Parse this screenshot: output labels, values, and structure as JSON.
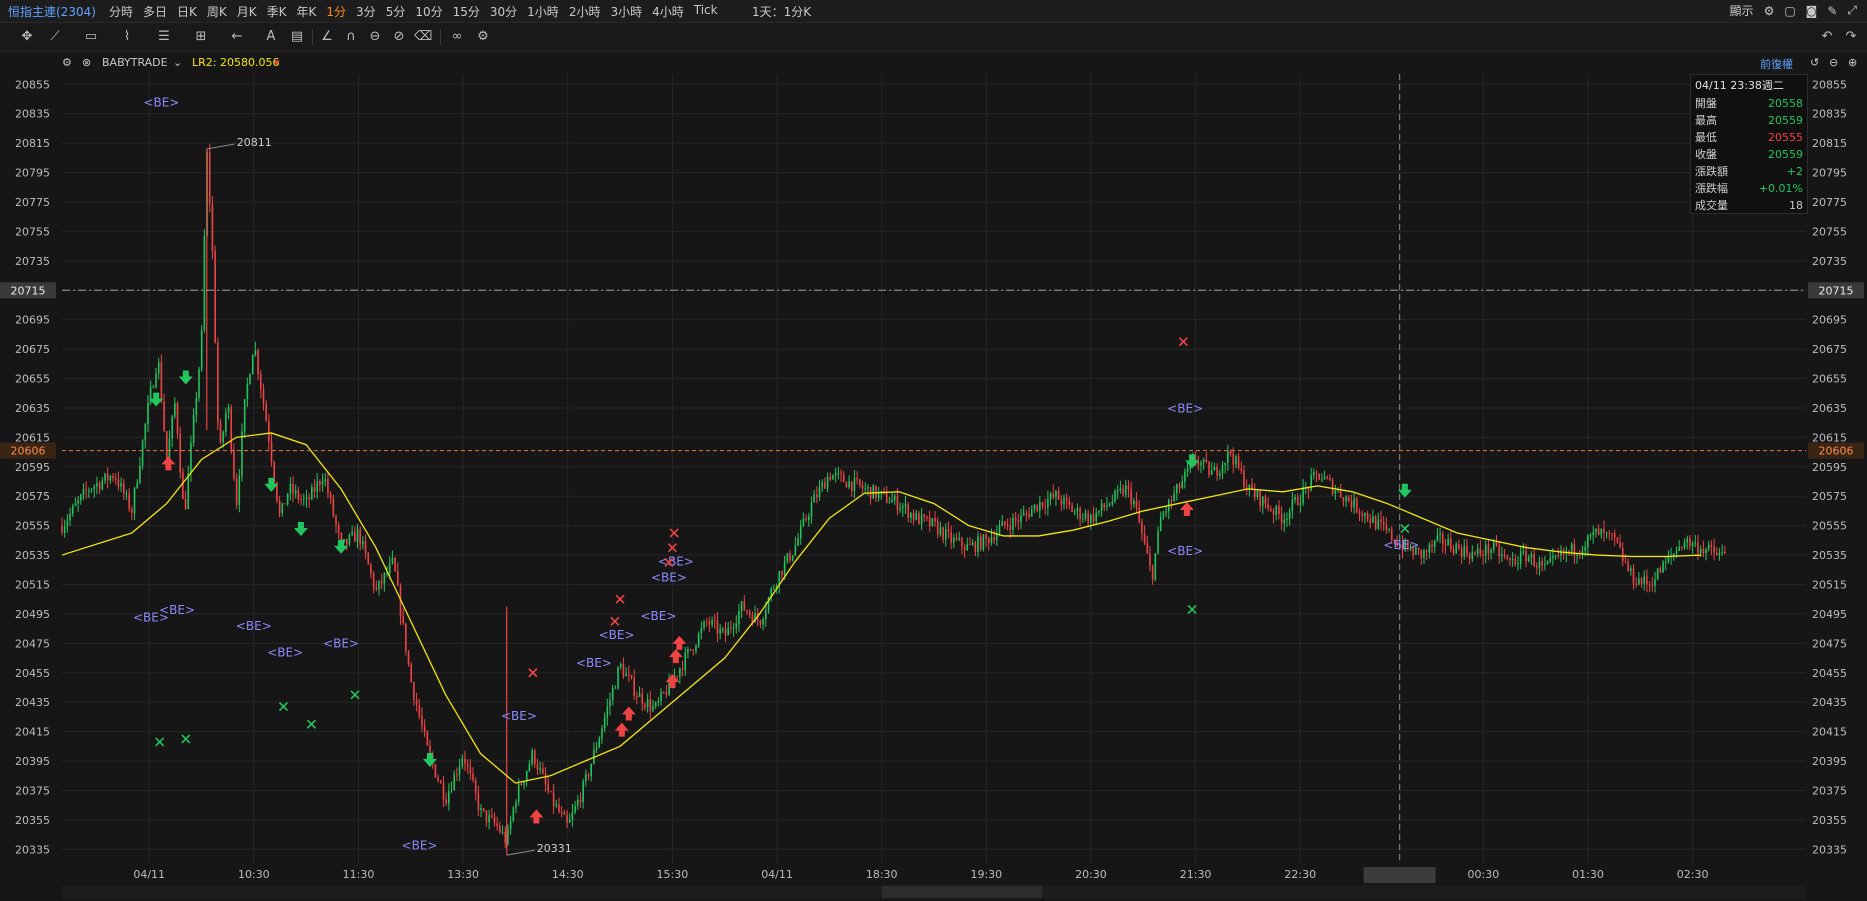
{
  "header": {
    "title": "恒指主連(2304)",
    "periods": [
      {
        "label": "分時"
      },
      {
        "label": "多日"
      },
      {
        "label": "日K"
      },
      {
        "label": "周K"
      },
      {
        "label": "月K"
      },
      {
        "label": "季K"
      },
      {
        "label": "年K"
      },
      {
        "label": "1分",
        "active": true
      },
      {
        "label": "3分"
      },
      {
        "label": "5分"
      },
      {
        "label": "10分"
      },
      {
        "label": "15分"
      },
      {
        "label": "30分"
      },
      {
        "label": "1小時"
      },
      {
        "label": "2小時"
      },
      {
        "label": "3小時"
      },
      {
        "label": "4小時"
      },
      {
        "label": "Tick"
      }
    ],
    "range_select": "1天：1分K",
    "display_label": "顯示",
    "restore_label": "前復權"
  },
  "indicator": {
    "name": "BABYTRADE",
    "lr2_label": "LR2:",
    "lr2_value": "20580.056"
  },
  "infobox": {
    "date": "04/11 23:38週二",
    "rows": [
      {
        "label": "開盤",
        "value": "20558",
        "color": "#22c55e"
      },
      {
        "label": "最高",
        "value": "20559",
        "color": "#22c55e"
      },
      {
        "label": "最低",
        "value": "20555",
        "color": "#ef4444"
      },
      {
        "label": "收盤",
        "value": "20559",
        "color": "#22c55e"
      },
      {
        "label": "漲跌額",
        "value": "+2",
        "color": "#22c55e"
      },
      {
        "label": "漲跌幅",
        "value": "+0.01%",
        "color": "#22c55e"
      },
      {
        "label": "成交量",
        "value": "18",
        "color": "#c8c8c8"
      }
    ]
  },
  "chart_data": {
    "type": "candlestick",
    "y_ticks": [
      20855,
      20835,
      20815,
      20795,
      20775,
      20755,
      20735,
      20715,
      20695,
      20675,
      20655,
      20635,
      20615,
      20595,
      20575,
      20555,
      20535,
      20515,
      20495,
      20475,
      20455,
      20435,
      20415,
      20395,
      20375,
      20355,
      20335
    ],
    "ylim": [
      20325,
      20862
    ],
    "x_ticks": [
      {
        "label": "04/11",
        "t": 0.05
      },
      {
        "label": "10:30",
        "t": 0.11
      },
      {
        "label": "11:30",
        "t": 0.17
      },
      {
        "label": "13:30",
        "t": 0.23
      },
      {
        "label": "14:30",
        "t": 0.29
      },
      {
        "label": "15:30",
        "t": 0.35
      },
      {
        "label": "04/11",
        "t": 0.41
      },
      {
        "label": "18:30",
        "t": 0.47
      },
      {
        "label": "19:30",
        "t": 0.53
      },
      {
        "label": "20:30",
        "t": 0.59
      },
      {
        "label": "21:30",
        "t": 0.65
      },
      {
        "label": "22:30",
        "t": 0.71
      },
      {
        "label": "04/11 23:38",
        "t": 0.767
      },
      {
        "label": "00:30",
        "t": 0.815
      },
      {
        "label": "01:30",
        "t": 0.875
      },
      {
        "label": "02:30",
        "t": 0.935
      }
    ],
    "price_path": [
      [
        0,
        20555
      ],
      [
        0.015,
        20580
      ],
      [
        0.03,
        20590
      ],
      [
        0.04,
        20565
      ],
      [
        0.05,
        20640
      ],
      [
        0.055,
        20670
      ],
      [
        0.06,
        20600
      ],
      [
        0.065,
        20640
      ],
      [
        0.07,
        20560
      ],
      [
        0.075,
        20620
      ],
      [
        0.08,
        20680
      ],
      [
        0.083,
        20810
      ],
      [
        0.086,
        20750
      ],
      [
        0.09,
        20600
      ],
      [
        0.095,
        20640
      ],
      [
        0.1,
        20570
      ],
      [
        0.105,
        20640
      ],
      [
        0.11,
        20680
      ],
      [
        0.118,
        20620
      ],
      [
        0.125,
        20560
      ],
      [
        0.13,
        20580
      ],
      [
        0.14,
        20570
      ],
      [
        0.15,
        20590
      ],
      [
        0.16,
        20540
      ],
      [
        0.17,
        20550
      ],
      [
        0.18,
        20510
      ],
      [
        0.19,
        20530
      ],
      [
        0.2,
        20450
      ],
      [
        0.21,
        20400
      ],
      [
        0.22,
        20370
      ],
      [
        0.23,
        20400
      ],
      [
        0.24,
        20360
      ],
      [
        0.25,
        20350
      ],
      [
        0.255,
        20340
      ],
      [
        0.26,
        20370
      ],
      [
        0.27,
        20400
      ],
      [
        0.28,
        20370
      ],
      [
        0.29,
        20350
      ],
      [
        0.3,
        20380
      ],
      [
        0.31,
        20420
      ],
      [
        0.32,
        20460
      ],
      [
        0.33,
        20440
      ],
      [
        0.34,
        20430
      ],
      [
        0.35,
        20450
      ],
      [
        0.36,
        20470
      ],
      [
        0.37,
        20490
      ],
      [
        0.38,
        20480
      ],
      [
        0.39,
        20500
      ],
      [
        0.4,
        20490
      ],
      [
        0.41,
        20520
      ],
      [
        0.42,
        20540
      ],
      [
        0.43,
        20570
      ],
      [
        0.44,
        20590
      ],
      [
        0.45,
        20585
      ],
      [
        0.46,
        20580
      ],
      [
        0.47,
        20575
      ],
      [
        0.48,
        20570
      ],
      [
        0.49,
        20560
      ],
      [
        0.5,
        20555
      ],
      [
        0.51,
        20545
      ],
      [
        0.52,
        20540
      ],
      [
        0.53,
        20545
      ],
      [
        0.54,
        20555
      ],
      [
        0.55,
        20560
      ],
      [
        0.56,
        20570
      ],
      [
        0.57,
        20575
      ],
      [
        0.58,
        20565
      ],
      [
        0.59,
        20560
      ],
      [
        0.6,
        20570
      ],
      [
        0.61,
        20580
      ],
      [
        0.615,
        20570
      ],
      [
        0.62,
        20545
      ],
      [
        0.625,
        20520
      ],
      [
        0.63,
        20560
      ],
      [
        0.64,
        20580
      ],
      [
        0.65,
        20600
      ],
      [
        0.66,
        20590
      ],
      [
        0.67,
        20605
      ],
      [
        0.68,
        20580
      ],
      [
        0.69,
        20570
      ],
      [
        0.7,
        20560
      ],
      [
        0.71,
        20575
      ],
      [
        0.72,
        20590
      ],
      [
        0.73,
        20580
      ],
      [
        0.74,
        20570
      ],
      [
        0.75,
        20560
      ],
      [
        0.76,
        20550
      ],
      [
        0.77,
        20540
      ],
      [
        0.78,
        20535
      ],
      [
        0.79,
        20545
      ],
      [
        0.8,
        20540
      ],
      [
        0.81,
        20535
      ],
      [
        0.82,
        20540
      ],
      [
        0.83,
        20530
      ],
      [
        0.84,
        20535
      ],
      [
        0.85,
        20525
      ],
      [
        0.86,
        20535
      ],
      [
        0.87,
        20540
      ],
      [
        0.88,
        20550
      ],
      [
        0.89,
        20545
      ],
      [
        0.9,
        20520
      ],
      [
        0.91,
        20515
      ],
      [
        0.92,
        20530
      ],
      [
        0.93,
        20545
      ],
      [
        0.94,
        20540
      ],
      [
        0.95,
        20535
      ]
    ],
    "lr2_line": [
      [
        0,
        20535
      ],
      [
        0.04,
        20550
      ],
      [
        0.06,
        20570
      ],
      [
        0.08,
        20600
      ],
      [
        0.1,
        20615
      ],
      [
        0.12,
        20618
      ],
      [
        0.14,
        20610
      ],
      [
        0.16,
        20580
      ],
      [
        0.18,
        20540
      ],
      [
        0.2,
        20490
      ],
      [
        0.22,
        20440
      ],
      [
        0.24,
        20400
      ],
      [
        0.26,
        20380
      ],
      [
        0.28,
        20385
      ],
      [
        0.3,
        20395
      ],
      [
        0.32,
        20405
      ],
      [
        0.34,
        20425
      ],
      [
        0.36,
        20445
      ],
      [
        0.38,
        20465
      ],
      [
        0.4,
        20495
      ],
      [
        0.42,
        20530
      ],
      [
        0.44,
        20560
      ],
      [
        0.46,
        20577
      ],
      [
        0.48,
        20578
      ],
      [
        0.5,
        20570
      ],
      [
        0.52,
        20555
      ],
      [
        0.54,
        20548
      ],
      [
        0.56,
        20548
      ],
      [
        0.58,
        20552
      ],
      [
        0.6,
        20558
      ],
      [
        0.62,
        20565
      ],
      [
        0.64,
        20570
      ],
      [
        0.66,
        20575
      ],
      [
        0.68,
        20580
      ],
      [
        0.7,
        20578
      ],
      [
        0.72,
        20582
      ],
      [
        0.74,
        20578
      ],
      [
        0.76,
        20570
      ],
      [
        0.78,
        20560
      ],
      [
        0.8,
        20550
      ],
      [
        0.82,
        20545
      ],
      [
        0.84,
        20540
      ],
      [
        0.86,
        20537
      ],
      [
        0.88,
        20535
      ],
      [
        0.9,
        20534
      ],
      [
        0.92,
        20534
      ],
      [
        0.94,
        20535
      ]
    ],
    "h_lines": [
      {
        "value": 20715,
        "label": "20715",
        "color": "#9a9a9a",
        "style": "dashdot"
      },
      {
        "value": 20606,
        "label": "20606",
        "color": "#e07b39",
        "style": "dashed"
      }
    ],
    "crosshair_t": 0.767,
    "annotations": [
      {
        "t": 0.083,
        "value": 20811,
        "text": "20811"
      },
      {
        "t": 0.255,
        "value": 20331,
        "text": "20331"
      }
    ],
    "signals": [
      {
        "kind": "BE",
        "t": 0.057,
        "value": 20840
      },
      {
        "kind": "BE",
        "t": 0.051,
        "value": 20490
      },
      {
        "kind": "BE",
        "t": 0.066,
        "value": 20495
      },
      {
        "kind": "BE",
        "t": 0.11,
        "value": 20484
      },
      {
        "kind": "BE",
        "t": 0.128,
        "value": 20466
      },
      {
        "kind": "BE",
        "t": 0.16,
        "value": 20472
      },
      {
        "kind": "BE",
        "t": 0.205,
        "value": 20335
      },
      {
        "kind": "BE",
        "t": 0.262,
        "value": 20423
      },
      {
        "kind": "BE",
        "t": 0.305,
        "value": 20459
      },
      {
        "kind": "BE",
        "t": 0.318,
        "value": 20478
      },
      {
        "kind": "BE",
        "t": 0.342,
        "value": 20491
      },
      {
        "kind": "BE",
        "t": 0.348,
        "value": 20517
      },
      {
        "kind": "BE",
        "t": 0.352,
        "value": 20528
      },
      {
        "kind": "BE",
        "t": 0.644,
        "value": 20632
      },
      {
        "kind": "BE",
        "t": 0.644,
        "value": 20535
      },
      {
        "kind": "BE",
        "t": 0.768,
        "value": 20539
      },
      {
        "kind": "down",
        "t": 0.054,
        "value": 20640
      },
      {
        "kind": "down",
        "t": 0.071,
        "value": 20655
      },
      {
        "kind": "down",
        "t": 0.12,
        "value": 20582
      },
      {
        "kind": "down",
        "t": 0.137,
        "value": 20552
      },
      {
        "kind": "down",
        "t": 0.16,
        "value": 20540
      },
      {
        "kind": "down",
        "t": 0.211,
        "value": 20395
      },
      {
        "kind": "down",
        "t": 0.648,
        "value": 20598
      },
      {
        "kind": "down",
        "t": 0.77,
        "value": 20578
      },
      {
        "kind": "up",
        "t": 0.061,
        "value": 20598
      },
      {
        "kind": "up",
        "t": 0.272,
        "value": 20358
      },
      {
        "kind": "up",
        "t": 0.321,
        "value": 20417
      },
      {
        "kind": "up",
        "t": 0.325,
        "value": 20428
      },
      {
        "kind": "up",
        "t": 0.35,
        "value": 20450
      },
      {
        "kind": "up",
        "t": 0.352,
        "value": 20467
      },
      {
        "kind": "up",
        "t": 0.354,
        "value": 20476
      },
      {
        "kind": "up",
        "t": 0.645,
        "value": 20567
      },
      {
        "kind": "xr",
        "t": 0.27,
        "value": 20455
      },
      {
        "kind": "xr",
        "t": 0.317,
        "value": 20490
      },
      {
        "kind": "xr",
        "t": 0.32,
        "value": 20505
      },
      {
        "kind": "xr",
        "t": 0.348,
        "value": 20530
      },
      {
        "kind": "xr",
        "t": 0.35,
        "value": 20540
      },
      {
        "kind": "xr",
        "t": 0.351,
        "value": 20550
      },
      {
        "kind": "xr",
        "t": 0.643,
        "value": 20680
      },
      {
        "kind": "xg",
        "t": 0.056,
        "value": 20408
      },
      {
        "kind": "xg",
        "t": 0.071,
        "value": 20410
      },
      {
        "kind": "xg",
        "t": 0.127,
        "value": 20432
      },
      {
        "kind": "xg",
        "t": 0.143,
        "value": 20420
      },
      {
        "kind": "xg",
        "t": 0.168,
        "value": 20440
      },
      {
        "kind": "xg",
        "t": 0.648,
        "value": 20498
      },
      {
        "kind": "xg",
        "t": 0.77,
        "value": 20553
      }
    ],
    "colors": {
      "up": "#22c55e",
      "down": "#ef4444",
      "lr2": "#f5e50a",
      "be": "#8b8bff",
      "grid": "#262626"
    }
  }
}
